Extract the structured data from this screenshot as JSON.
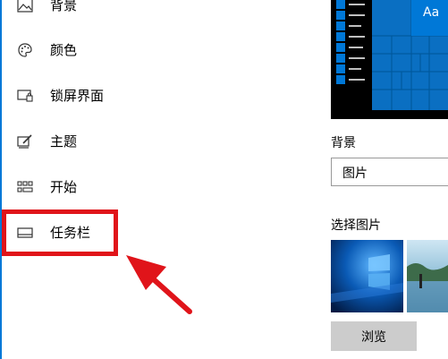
{
  "nav": {
    "items": [
      {
        "label": "背景",
        "icon": "picture-icon"
      },
      {
        "label": "颜色",
        "icon": "palette-icon"
      },
      {
        "label": "锁屏界面",
        "icon": "lock-screen-icon"
      },
      {
        "label": "主题",
        "icon": "theme-icon"
      },
      {
        "label": "开始",
        "icon": "start-icon"
      },
      {
        "label": "任务栏",
        "icon": "taskbar-icon"
      }
    ]
  },
  "preview": {
    "tile_label": "Aa"
  },
  "background_section": {
    "label": "背景",
    "dropdown_value": "图片"
  },
  "choose_picture": {
    "label": "选择图片",
    "browse_label": "浏览"
  },
  "colors": {
    "accent": "#0078d7",
    "highlight": "#e0141a"
  }
}
